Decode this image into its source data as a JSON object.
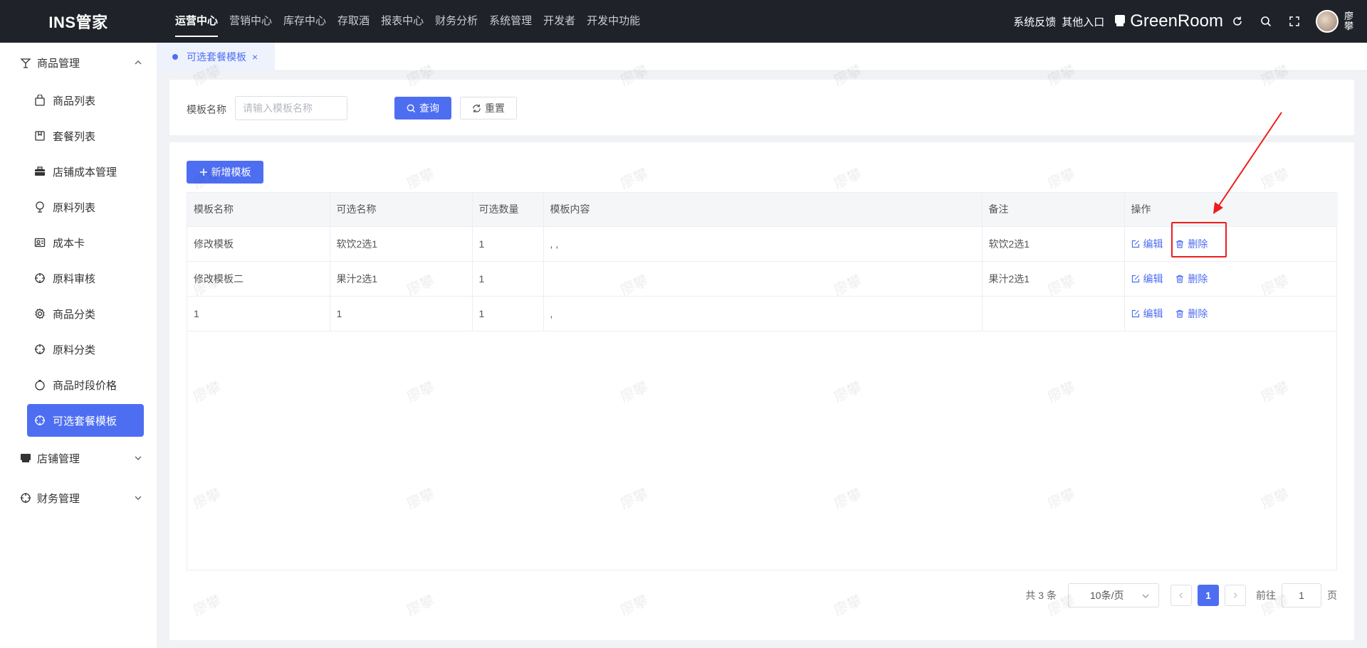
{
  "app": {
    "logo": "INS管家"
  },
  "topnav": [
    {
      "label": "运营中心",
      "active": true
    },
    {
      "label": "营销中心"
    },
    {
      "label": "库存中心"
    },
    {
      "label": "存取酒"
    },
    {
      "label": "报表中心"
    },
    {
      "label": "财务分析"
    },
    {
      "label": "系统管理"
    },
    {
      "label": "开发者"
    },
    {
      "label": "开发中功能"
    }
  ],
  "topright": {
    "feedback": "系统反馈",
    "other_entry": "其他入口",
    "store": "GreenRoom",
    "user": "廖攀"
  },
  "sidebar": {
    "groups": [
      {
        "label": "商品管理",
        "icon": "goods-icon",
        "expanded": true
      },
      {
        "label": "店铺管理",
        "icon": "store-icon",
        "expanded": false
      },
      {
        "label": "财务管理",
        "icon": "finance-icon",
        "expanded": false
      }
    ],
    "items": [
      {
        "label": "商品列表",
        "icon": "bag-icon"
      },
      {
        "label": "套餐列表",
        "icon": "package-icon"
      },
      {
        "label": "店铺成本管理",
        "icon": "briefcase-icon"
      },
      {
        "label": "原料列表",
        "icon": "ingredient-icon"
      },
      {
        "label": "成本卡",
        "icon": "card-icon"
      },
      {
        "label": "原料审核",
        "icon": "target-icon"
      },
      {
        "label": "商品分类",
        "icon": "settings-icon"
      },
      {
        "label": "原料分类",
        "icon": "target-icon"
      },
      {
        "label": "商品时段价格",
        "icon": "clock-icon"
      },
      {
        "label": "可选套餐模板",
        "icon": "target-icon",
        "active": true
      }
    ]
  },
  "tabs": [
    {
      "label": "可选套餐模板",
      "closable": true
    }
  ],
  "search": {
    "label": "模板名称",
    "placeholder": "请输入模板名称",
    "value": "",
    "query_label": "查询",
    "reset_label": "重置"
  },
  "toolbar": {
    "add_label": "新增模板"
  },
  "table": {
    "columns": [
      "模板名称",
      "可选名称",
      "可选数量",
      "模板内容",
      "备注",
      "操作"
    ],
    "rows": [
      {
        "name": "修改模板",
        "option_name": "软饮2选1",
        "qty": "1",
        "content": ", ,",
        "remark": "软饮2选1"
      },
      {
        "name": "修改模板二",
        "option_name": "果汁2选1",
        "qty": "1",
        "content": "",
        "remark": "果汁2选1"
      },
      {
        "name": "1",
        "option_name": "1",
        "qty": "1",
        "content": ",",
        "remark": ""
      }
    ],
    "edit_label": "编辑",
    "delete_label": "删除"
  },
  "pagination": {
    "total_text": "共 3 条",
    "page_size": "10条/页",
    "current_page": "1",
    "goto_label": "前往",
    "goto_value": "1",
    "page_unit": "页"
  },
  "watermark": "廖攀",
  "colors": {
    "primary": "#4e6ef2",
    "topbar": "#1f2229",
    "annotation": "#ee1c1c"
  }
}
